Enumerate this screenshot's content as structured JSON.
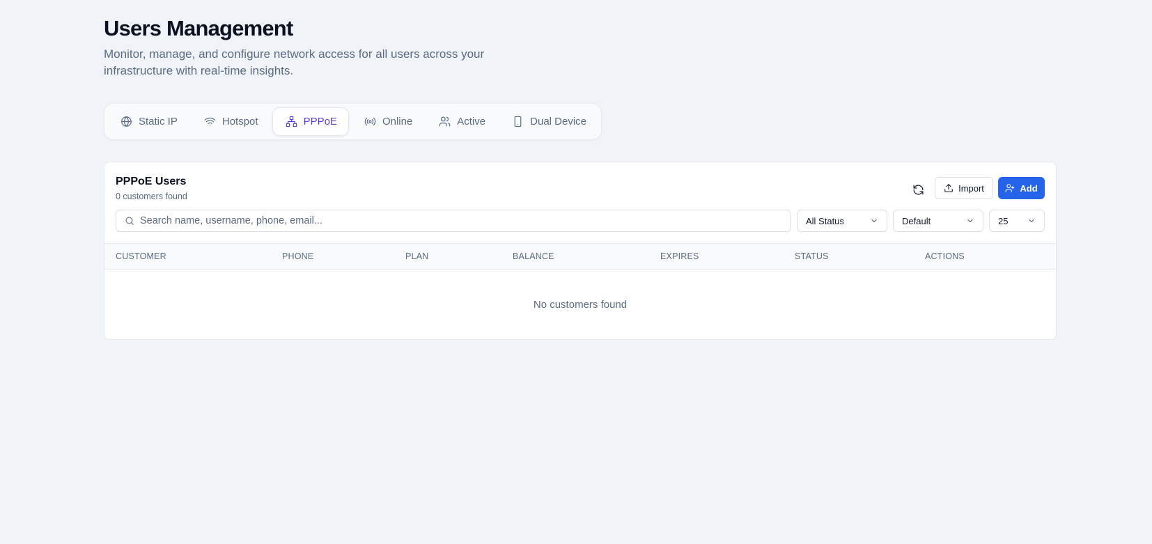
{
  "header": {
    "title": "Users Management",
    "subtitle": "Monitor, manage, and configure network access for all users across your infrastructure with real-time insights."
  },
  "tabs": [
    {
      "label": "Static IP",
      "icon": "globe-icon",
      "active": false
    },
    {
      "label": "Hotspot",
      "icon": "wifi-icon",
      "active": false
    },
    {
      "label": "PPPoE",
      "icon": "network-icon",
      "active": true
    },
    {
      "label": "Online",
      "icon": "radio-icon",
      "active": false
    },
    {
      "label": "Active",
      "icon": "users-icon",
      "active": false
    },
    {
      "label": "Dual Device",
      "icon": "smartphone-icon",
      "active": false
    }
  ],
  "card": {
    "title": "PPPoE Users",
    "count": "0 customers found",
    "import_label": "Import",
    "add_label": "Add",
    "search_placeholder": "Search name, username, phone, email...",
    "status_filter": "All Status",
    "sort": "Default",
    "page_size": "25",
    "columns": [
      "CUSTOMER",
      "PHONE",
      "PLAN",
      "BALANCE",
      "EXPIRES",
      "STATUS",
      "ACTIONS"
    ],
    "empty_message": "No customers found"
  },
  "colors": {
    "accent": "#5b3fd6",
    "primary": "#2563eb",
    "background": "#f0f4f9"
  }
}
